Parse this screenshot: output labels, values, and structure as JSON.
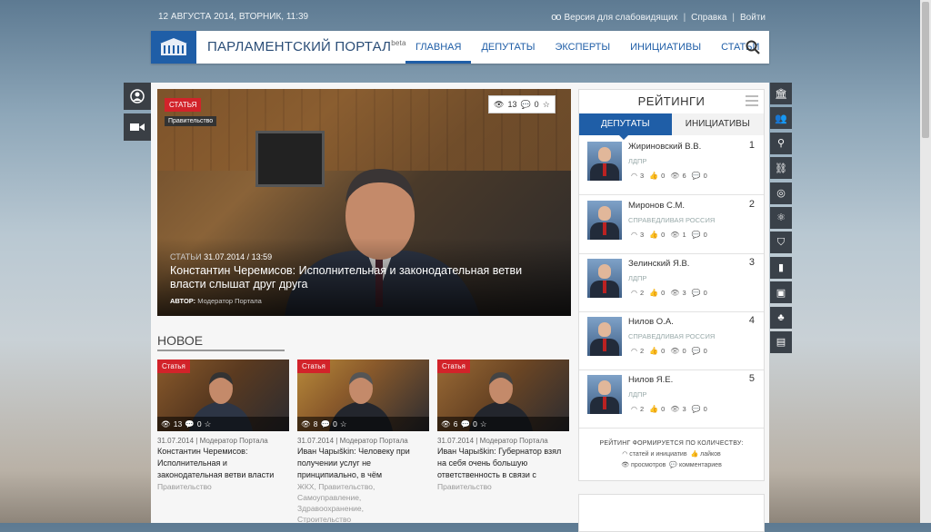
{
  "topbar": {
    "date": "12 АВГУСТА 2014, ВТОРНИК, 11:39",
    "accessibility": "Версия для слабовидящих",
    "help": "Справка",
    "login": "Войти",
    "sep": "|"
  },
  "header": {
    "logo_text": "ПАРЛАМЕНТСКИЙ ПОРТАЛ",
    "logo_sup": "beta",
    "menu": [
      "ГЛАВНАЯ",
      "ДЕПУТАТЫ",
      "ЭКСПЕРТЫ",
      "ИНИЦИАТИВЫ",
      "СТАТЬИ"
    ]
  },
  "hero": {
    "tag": "СТАТЬЯ",
    "sub_tag": "Правительство",
    "views": "13",
    "comments": "0",
    "meta_cat": "СТАТЬИ",
    "meta_date": "31.07.2014 / 13:59",
    "title": "Константин Черемисов: Исполнительная и законодательная ветви власти слышат друг друга",
    "author_label": "АВТОР:",
    "author": "Модератор Портала"
  },
  "new_section": {
    "heading": "НОВОЕ",
    "cards": [
      {
        "tag": "Статья",
        "views": "13",
        "comments": "0",
        "meta": "31.07.2014 | Модератор Портала",
        "title": "Константин Черемисов: Исполнительная и законодательная ветви власти",
        "cats": [
          "Правительство"
        ]
      },
      {
        "tag": "Статья",
        "views": "8",
        "comments": "0",
        "meta": "31.07.2014 | Модератор Портала",
        "title": "Иван Чарыškin: Человеку при получении услуг не принципиально, в чём",
        "cats": [
          "ЖКХ,",
          "Правительство,",
          "Самоуправление,",
          "Здравоохранение,",
          "Строительство"
        ]
      },
      {
        "tag": "Статья",
        "views": "6",
        "comments": "0",
        "meta": "31.07.2014 | Модератор Портала",
        "title": "Иван Чарыškin: Губернатор взял на себя очень большую ответственность в связи с",
        "cats": [
          "Правительство"
        ]
      }
    ]
  },
  "rating": {
    "title": "РЕЙТИНГИ",
    "tabs": [
      "ДЕПУТАТЫ",
      "ИНИЦИАТИВЫ"
    ],
    "rows": [
      {
        "name": "Жириновский В.В.",
        "rank": "1",
        "party": "ЛДПР",
        "a": "3",
        "b": "0",
        "c": "6",
        "d": "0"
      },
      {
        "name": "Миронов С.М.",
        "rank": "2",
        "party": "СПРАВЕДЛИВАЯ РОССИЯ",
        "a": "3",
        "b": "0",
        "c": "1",
        "d": "0"
      },
      {
        "name": "Зелинский Я.В.",
        "rank": "3",
        "party": "ЛДПР",
        "a": "2",
        "b": "0",
        "c": "3",
        "d": "0"
      },
      {
        "name": "Нилов О.А.",
        "rank": "4",
        "party": "СПРАВЕДЛИВАЯ РОССИЯ",
        "a": "2",
        "b": "0",
        "c": "0",
        "d": "0"
      },
      {
        "name": "Нилов Я.Е.",
        "rank": "5",
        "party": "ЛДПР",
        "a": "2",
        "b": "0",
        "c": "3",
        "d": "0"
      }
    ],
    "footer_heading": "РЕЙТИНГ ФОРМИРУЕТСЯ ПО КОЛИЧЕСТВУ:",
    "legend": [
      "статей и инициатив",
      "лайков",
      "просмотров",
      "комментариев"
    ]
  },
  "colors": {
    "brand": "#1f5ea7",
    "tag_red": "#d2232a",
    "toolbar": "#3a4149"
  },
  "icons": {
    "left": [
      "user-icon",
      "video-icon"
    ],
    "right": [
      "building-icon",
      "people-icon",
      "location-icon",
      "tags-icon",
      "globe-icon",
      "atom-icon",
      "shield-icon",
      "chart-icon",
      "briefcase-icon",
      "tree-icon",
      "chat-icon"
    ]
  }
}
